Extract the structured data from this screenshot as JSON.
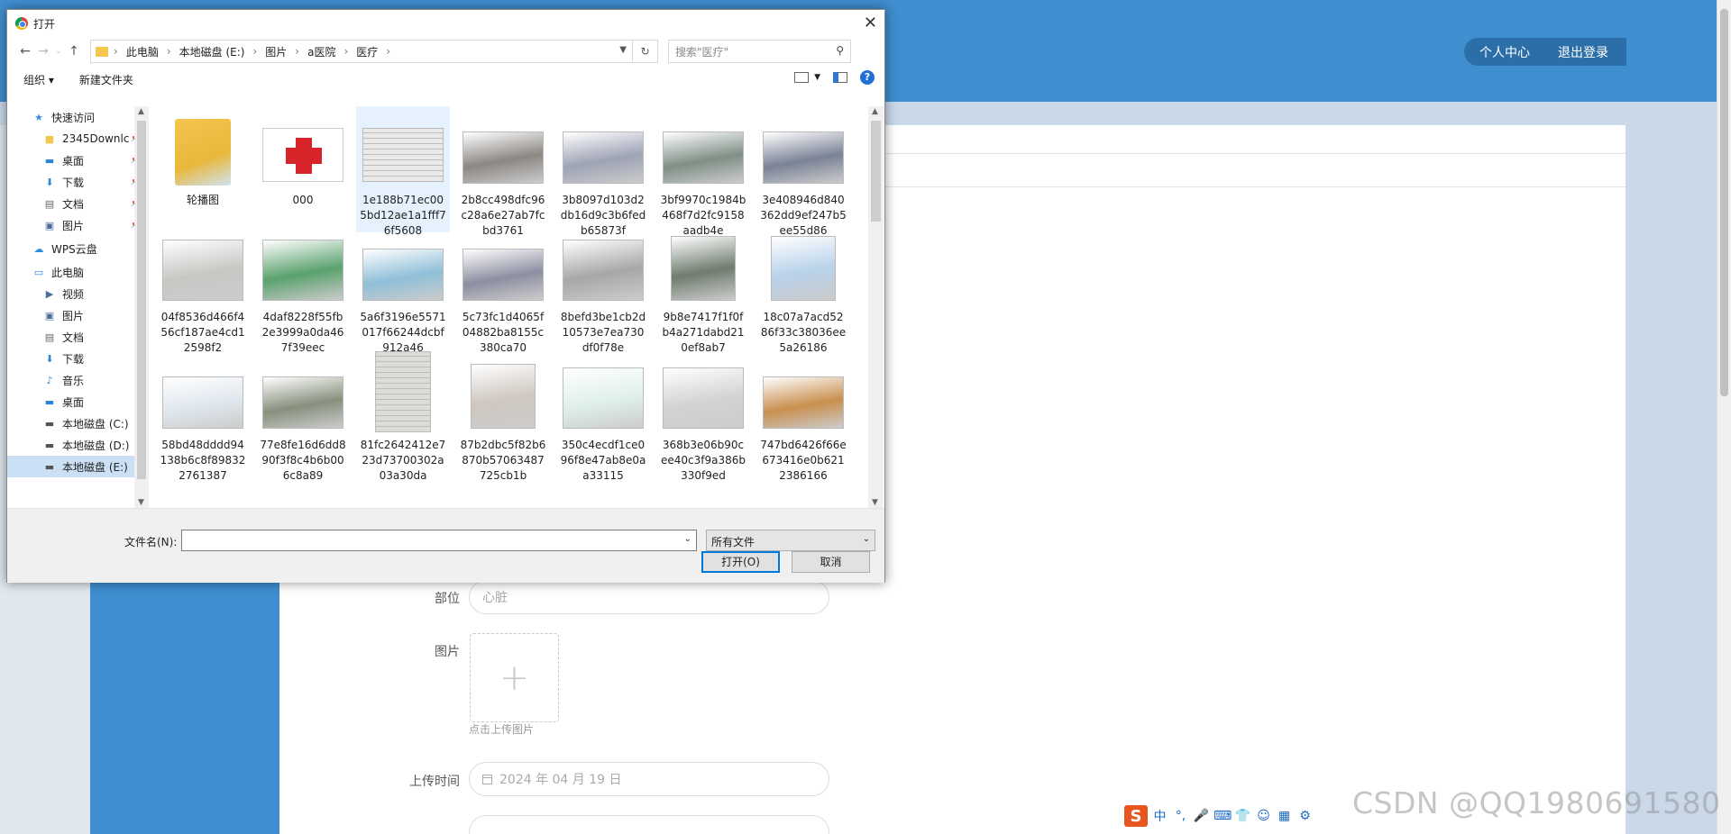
{
  "page": {
    "header_links": [
      "个人中心",
      "退出登录"
    ],
    "form": {
      "part_label": "部位",
      "part_placeholder": "心脏",
      "image_label": "图片",
      "upload_hint": "点击上传图片",
      "upload_time_label": "上传时间",
      "upload_time_value": "2024 年 04 月 19 日"
    },
    "watermark": "CSDN @QQ1980691580",
    "ime_logo": "S",
    "ime_mode": "中"
  },
  "dialog": {
    "title": "打开",
    "breadcrumb": [
      "此电脑",
      "本地磁盘 (E:)",
      "图片",
      "a医院",
      "医疗"
    ],
    "search_placeholder": "搜索\"医疗\"",
    "toolbar": {
      "organize": "组织 ▾",
      "new_folder": "新建文件夹",
      "help": "?"
    },
    "tree": [
      {
        "label": "快速访问",
        "icon": "star-icon",
        "indent": 1,
        "pinned": false
      },
      {
        "label": "2345Downlc",
        "icon": "folder-icon",
        "indent": 2,
        "pinned": true
      },
      {
        "label": "桌面",
        "icon": "desktop-icon",
        "indent": 2,
        "pinned": true
      },
      {
        "label": "下载",
        "icon": "download-icon",
        "indent": 2,
        "pinned": true
      },
      {
        "label": "文档",
        "icon": "document-icon",
        "indent": 2,
        "pinned": true
      },
      {
        "label": "图片",
        "icon": "picture-icon",
        "indent": 2,
        "pinned": true
      },
      {
        "label": "",
        "icon": "",
        "indent": 0,
        "pinned": false
      },
      {
        "label": "WPS云盘",
        "icon": "cloud-icon",
        "indent": 1,
        "pinned": false
      },
      {
        "label": "",
        "icon": "",
        "indent": 0,
        "pinned": false
      },
      {
        "label": "此电脑",
        "icon": "computer-icon",
        "indent": 1,
        "pinned": false
      },
      {
        "label": "视频",
        "icon": "video-icon",
        "indent": 2,
        "pinned": false
      },
      {
        "label": "图片",
        "icon": "picture-icon",
        "indent": 2,
        "pinned": false
      },
      {
        "label": "文档",
        "icon": "document-icon",
        "indent": 2,
        "pinned": false
      },
      {
        "label": "下载",
        "icon": "download-icon",
        "indent": 2,
        "pinned": false
      },
      {
        "label": "音乐",
        "icon": "music-icon",
        "indent": 2,
        "pinned": false
      },
      {
        "label": "桌面",
        "icon": "desktop-icon",
        "indent": 2,
        "pinned": false
      },
      {
        "label": "本地磁盘 (C:)",
        "icon": "drive-icon",
        "indent": 2,
        "pinned": false
      },
      {
        "label": "本地磁盘 (D:)",
        "icon": "drive-icon",
        "indent": 2,
        "pinned": false
      },
      {
        "label": "本地磁盘 (E:)",
        "icon": "drive-icon",
        "indent": 2,
        "pinned": false,
        "selected": true
      }
    ],
    "files": [
      {
        "name": "轮播图",
        "kind": "folder",
        "color": "#f3c64f"
      },
      {
        "name": "000",
        "kind": "redcross",
        "color": "#d8232a"
      },
      {
        "name": "1e188b71ec005bd12ae1a1fff76f5608",
        "kind": "doc",
        "color": "#e9e9e9",
        "selected": true
      },
      {
        "name": "2b8cc498dfc96c28a6e27ab7fcbd3761",
        "kind": "photo",
        "color": "#8b8783"
      },
      {
        "name": "3b8097d103d2db16d9c3b6fedb65873f",
        "kind": "photo",
        "color": "#9ea3b5"
      },
      {
        "name": "3bf9970c1984b468f7d2fc9158aadb4e",
        "kind": "photo",
        "color": "#7f8f86"
      },
      {
        "name": "3e408946d840362dd9ef247b5ee55d86",
        "kind": "photo",
        "color": "#7a8296"
      },
      {
        "name": "04f8536d466f456cf187ae4cd12598f2",
        "kind": "photo",
        "color": "#c7c7c4"
      },
      {
        "name": "4daf8228f55fb2e3999a0da467f39eec",
        "kind": "photo",
        "color": "#5aa16d"
      },
      {
        "name": "5a6f3196e5571017f66244dcbf912a46",
        "kind": "photo",
        "color": "#8fbfd8"
      },
      {
        "name": "5c73fc1d4065f04882ba8155c380ca70",
        "kind": "photo",
        "color": "#8d8fa1"
      },
      {
        "name": "8befd3be1cb2d10573e7ea730df0f78e",
        "kind": "photo",
        "color": "#a7a7a7"
      },
      {
        "name": "9b8e7417f1f0fb4a271dabd210ef8ab7",
        "kind": "photo",
        "color": "#6f7c6e"
      },
      {
        "name": "18c07a7acd5286f33c38036ee5a26186",
        "kind": "photo",
        "color": "#b8d2ea"
      },
      {
        "name": "58bd48dddd94138b6c8f898322761387",
        "kind": "photo",
        "color": "#dfe7ee"
      },
      {
        "name": "77e8fe16d6dd890f3f8c4b6b006c8a89",
        "kind": "photo",
        "color": "#87907d"
      },
      {
        "name": "81fc2642412e723d73700302a03a30da",
        "kind": "doc",
        "color": "#dcdcd8"
      },
      {
        "name": "87b2dbc5f82b6870b57063487725cb1b",
        "kind": "photo",
        "color": "#cfc7c0"
      },
      {
        "name": "350c4ecdf1ce096f8e47ab8e0aa33115",
        "kind": "photo",
        "color": "#dff0ec"
      },
      {
        "name": "368b3e06b90cee40c3f9a386b330f9ed",
        "kind": "photo",
        "color": "#d3d3d3"
      },
      {
        "name": "747bd6426f66e673416e0b6212386166",
        "kind": "photo",
        "color": "#c98f4e"
      }
    ],
    "filename_label": "文件名(N):",
    "filename_value": "",
    "filetype": "所有文件",
    "open_button": "打开(O)",
    "cancel_button": "取消"
  }
}
